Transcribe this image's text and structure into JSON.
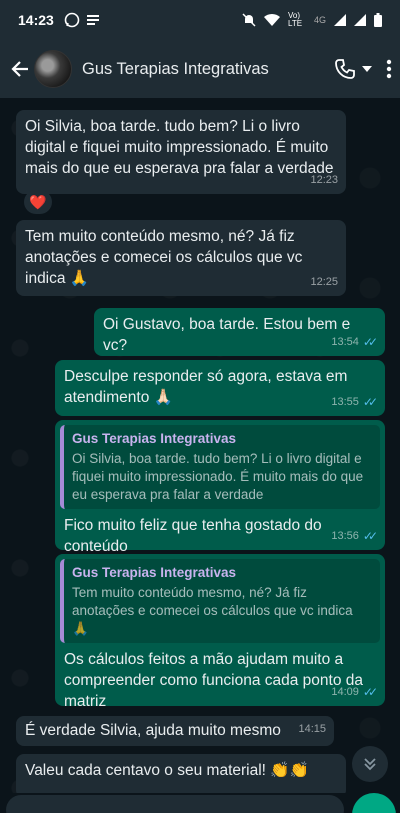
{
  "status_bar": {
    "time": "14:23",
    "network_label": "Vo) LTE",
    "network_type": "4G"
  },
  "header": {
    "contact_name": "Gus Terapias Integrativas"
  },
  "messages": [
    {
      "text": "Oi Silvia, boa tarde. tudo bem? Li o livro digital e fiquei muito impressionado. É muito mais do que eu esperava pra falar a verdade",
      "time": "12:23",
      "reaction": "❤️"
    },
    {
      "text": "Tem muito conteúdo mesmo, né? Já fiz anotações e comecei os cálculos que vc indica 🙏",
      "time": "12:25"
    },
    {
      "text": "Oi Gustavo, boa tarde. Estou bem e vc?",
      "time": "13:54"
    },
    {
      "text": "Desculpe responder só agora, estava em atendimento 🙏🏻",
      "time": "13:55"
    },
    {
      "quote_author": "Gus Terapias Integrativas",
      "quote_text": "Oi Silvia, boa tarde. tudo bem? Li o livro digital e fiquei muito impressionado. É muito mais do que eu esperava pra falar a verdade",
      "text": "Fico muito feliz que tenha gostado do conteúdo",
      "time": "13:56"
    },
    {
      "quote_author": "Gus Terapias Integrativas",
      "quote_text": "Tem muito conteúdo mesmo, né? Já fiz anotações e comecei os cálculos que vc indica 🙏",
      "text": "Os cálculos feitos a mão ajudam muito a compreender como funciona cada ponto da matriz",
      "time": "14:09"
    },
    {
      "text": "É verdade Silvia, ajuda muito mesmo",
      "time": "14:15"
    },
    {
      "text": "Valeu cada centavo o seu material! 👏👏"
    }
  ],
  "colors": {
    "incoming_bubble": "#1f2c34",
    "outgoing_bubble": "#005c4b",
    "read_ticks": "#53bdeb",
    "quote_bar": "#a58bd6",
    "accent": "#00a884"
  }
}
